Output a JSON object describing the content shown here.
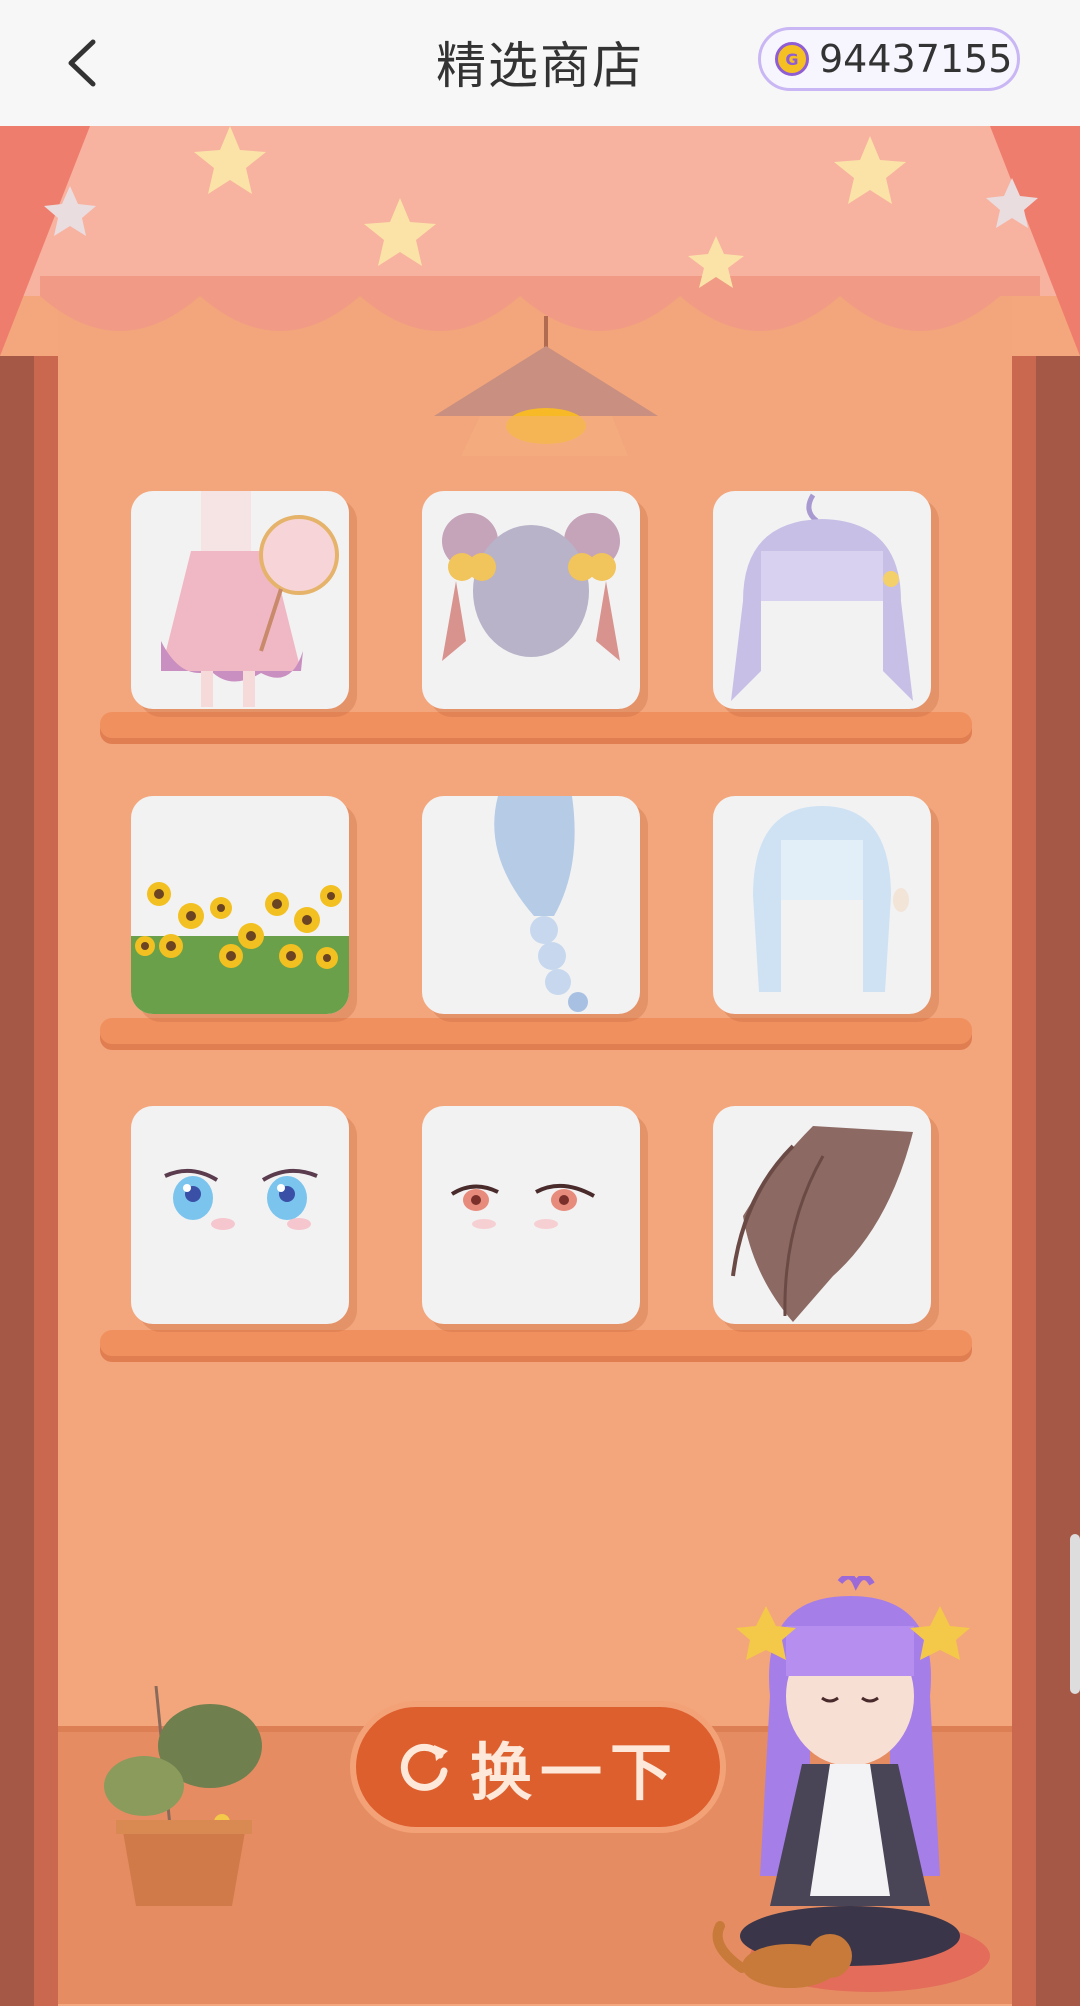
{
  "header": {
    "title": "精选商店",
    "back_icon": "chevron-left-icon",
    "coin_icon_letter": "G",
    "coin_balance": "94437155"
  },
  "shop": {
    "items": [
      {
        "name": "pink-hanfu-dress"
      },
      {
        "name": "bun-hair-with-bells"
      },
      {
        "name": "lavender-bob-hair"
      },
      {
        "name": "sunflower-field"
      },
      {
        "name": "braided-light-blue-hair"
      },
      {
        "name": "light-blue-straight-hair"
      },
      {
        "name": "blue-anime-eyes"
      },
      {
        "name": "red-anime-eyes"
      },
      {
        "name": "brown-long-hair"
      }
    ],
    "refresh_label": "换一下",
    "refresh_icon": "refresh-icon"
  },
  "colors": {
    "accent": "#dd5f2e",
    "wall": "#f3a67b",
    "coin_border": "#c9b6f4"
  }
}
